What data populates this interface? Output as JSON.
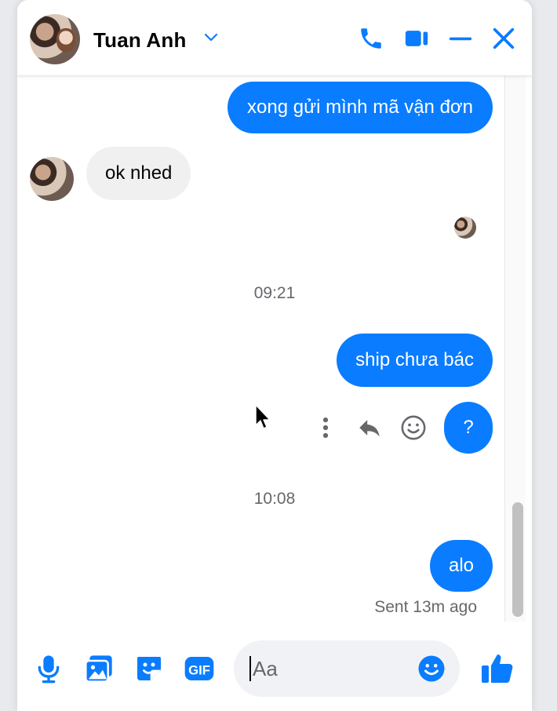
{
  "header": {
    "contact_name": "Tuan Anh",
    "icons": [
      "chevron-down-icon",
      "phone-icon",
      "video-icon",
      "minimize-icon",
      "close-icon"
    ]
  },
  "colors": {
    "accent": "#0a7cff",
    "incoming_bubble": "#f0f0f0",
    "muted_text": "#65676b"
  },
  "messages": [
    {
      "direction": "outgoing",
      "text": "xong gửi mình mã vận đơn"
    },
    {
      "direction": "incoming",
      "text": "ok nhed"
    },
    {
      "type": "timestamp",
      "text": "09:21"
    },
    {
      "direction": "outgoing",
      "text": "ship chưa bác"
    },
    {
      "direction": "outgoing",
      "text": "?"
    },
    {
      "type": "timestamp",
      "text": "10:08"
    },
    {
      "direction": "outgoing",
      "text": "alo"
    }
  ],
  "message_actions": [
    "more-options-icon",
    "reply-icon",
    "react-emoji-icon"
  ],
  "status": "Sent 13m ago",
  "composer": {
    "placeholder": "Aa",
    "icons": [
      "microphone-icon",
      "photo-icon",
      "sticker-icon",
      "gif-icon",
      "emoji-icon",
      "like-icon"
    ]
  }
}
